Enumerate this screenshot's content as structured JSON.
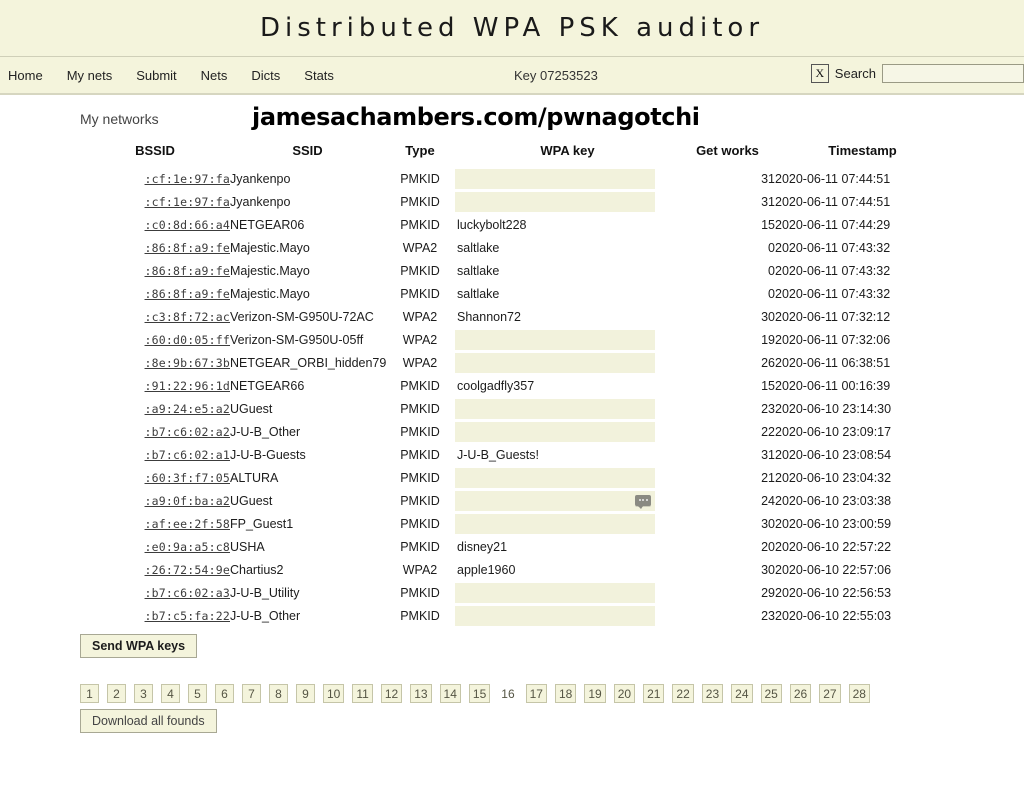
{
  "header": {
    "title": "Distributed WPA PSK auditor"
  },
  "nav": {
    "links": [
      {
        "label": "Home"
      },
      {
        "label": "My nets"
      },
      {
        "label": "Submit"
      },
      {
        "label": "Nets"
      },
      {
        "label": "Dicts"
      },
      {
        "label": "Stats"
      }
    ],
    "key_label": "Key 07253523",
    "close_label": "X",
    "search_label": "Search",
    "search_value": "",
    "search_placeholder": ""
  },
  "page": {
    "section_label": "My networks",
    "banner": "jamesachambers.com/pwnagotchi"
  },
  "table": {
    "columns": [
      "BSSID",
      "SSID",
      "Type",
      "WPA key",
      "Get works",
      "Timestamp"
    ],
    "rows": [
      {
        "bssid": ":cf:1e:97:fa",
        "ssid": "Jyankenpo",
        "type": "PMKID",
        "key": "",
        "key_is_input": true,
        "autofill": false,
        "works": "31",
        "timestamp": "2020-06-11 07:44:51"
      },
      {
        "bssid": ":cf:1e:97:fa",
        "ssid": "Jyankenpo",
        "type": "PMKID",
        "key": "",
        "key_is_input": true,
        "autofill": false,
        "works": "31",
        "timestamp": "2020-06-11 07:44:51"
      },
      {
        "bssid": ":c0:8d:66:a4",
        "ssid": "NETGEAR06",
        "type": "PMKID",
        "key": "luckybolt228",
        "key_is_input": false,
        "autofill": false,
        "works": "15",
        "timestamp": "2020-06-11 07:44:29"
      },
      {
        "bssid": ":86:8f:a9:fe",
        "ssid": "Majestic.Mayo",
        "type": "WPA2",
        "key": "saltlake",
        "key_is_input": false,
        "autofill": false,
        "works": "0",
        "timestamp": "2020-06-11 07:43:32"
      },
      {
        "bssid": ":86:8f:a9:fe",
        "ssid": "Majestic.Mayo",
        "type": "PMKID",
        "key": "saltlake",
        "key_is_input": false,
        "autofill": false,
        "works": "0",
        "timestamp": "2020-06-11 07:43:32"
      },
      {
        "bssid": ":86:8f:a9:fe",
        "ssid": "Majestic.Mayo",
        "type": "PMKID",
        "key": "saltlake",
        "key_is_input": false,
        "autofill": false,
        "works": "0",
        "timestamp": "2020-06-11 07:43:32"
      },
      {
        "bssid": ":c3:8f:72:ac",
        "ssid": "Verizon-SM-G950U-72AC",
        "type": "WPA2",
        "key": "Shannon72",
        "key_is_input": false,
        "autofill": false,
        "works": "30",
        "timestamp": "2020-06-11 07:32:12"
      },
      {
        "bssid": ":60:d0:05:ff",
        "ssid": "Verizon-SM-G950U-05ff",
        "type": "WPA2",
        "key": "",
        "key_is_input": true,
        "autofill": false,
        "works": "19",
        "timestamp": "2020-06-11 07:32:06"
      },
      {
        "bssid": ":8e:9b:67:3b",
        "ssid": "NETGEAR_ORBI_hidden79",
        "type": "WPA2",
        "key": "",
        "key_is_input": true,
        "autofill": false,
        "works": "26",
        "timestamp": "2020-06-11 06:38:51"
      },
      {
        "bssid": ":91:22:96:1d",
        "ssid": "NETGEAR66",
        "type": "PMKID",
        "key": "coolgadfly357",
        "key_is_input": false,
        "autofill": false,
        "works": "15",
        "timestamp": "2020-06-11 00:16:39"
      },
      {
        "bssid": ":a9:24:e5:a2",
        "ssid": "UGuest",
        "type": "PMKID",
        "key": "",
        "key_is_input": true,
        "autofill": false,
        "works": "23",
        "timestamp": "2020-06-10 23:14:30"
      },
      {
        "bssid": ":b7:c6:02:a2",
        "ssid": "J-U-B_Other",
        "type": "PMKID",
        "key": "",
        "key_is_input": true,
        "autofill": false,
        "works": "22",
        "timestamp": "2020-06-10 23:09:17"
      },
      {
        "bssid": ":b7:c6:02:a1",
        "ssid": "J-U-B-Guests",
        "type": "PMKID",
        "key": "J-U-B_Guests!",
        "key_is_input": false,
        "autofill": false,
        "works": "31",
        "timestamp": "2020-06-10 23:08:54"
      },
      {
        "bssid": ":60:3f:f7:05",
        "ssid": "ALTURA",
        "type": "PMKID",
        "key": "",
        "key_is_input": true,
        "autofill": false,
        "works": "21",
        "timestamp": "2020-06-10 23:04:32"
      },
      {
        "bssid": ":a9:0f:ba:a2",
        "ssid": "UGuest",
        "type": "PMKID",
        "key": "",
        "key_is_input": true,
        "autofill": true,
        "works": "24",
        "timestamp": "2020-06-10 23:03:38"
      },
      {
        "bssid": ":af:ee:2f:58",
        "ssid": "FP_Guest1",
        "type": "PMKID",
        "key": "",
        "key_is_input": true,
        "autofill": false,
        "works": "30",
        "timestamp": "2020-06-10 23:00:59"
      },
      {
        "bssid": ":e0:9a:a5:c8",
        "ssid": "USHA",
        "type": "PMKID",
        "key": "disney21",
        "key_is_input": false,
        "autofill": false,
        "works": "20",
        "timestamp": "2020-06-10 22:57:22"
      },
      {
        "bssid": ":26:72:54:9e",
        "ssid": "Chartius2",
        "type": "WPA2",
        "key": "apple1960",
        "key_is_input": false,
        "autofill": false,
        "works": "30",
        "timestamp": "2020-06-10 22:57:06"
      },
      {
        "bssid": ":b7:c6:02:a3",
        "ssid": "J-U-B_Utility",
        "type": "PMKID",
        "key": "",
        "key_is_input": true,
        "autofill": false,
        "works": "29",
        "timestamp": "2020-06-10 22:56:53"
      },
      {
        "bssid": ":b7:c5:fa:22",
        "ssid": "J-U-B_Other",
        "type": "PMKID",
        "key": "",
        "key_is_input": true,
        "autofill": false,
        "works": "23",
        "timestamp": "2020-06-10 22:55:03"
      }
    ]
  },
  "actions": {
    "send_keys_label": "Send WPA keys",
    "download_label": "Download all founds"
  },
  "pagination": {
    "current": "16",
    "pages": [
      "1",
      "2",
      "3",
      "4",
      "5",
      "6",
      "7",
      "8",
      "9",
      "10",
      "11",
      "12",
      "13",
      "14",
      "15",
      "16",
      "17",
      "18",
      "19",
      "20",
      "21",
      "22",
      "23",
      "24",
      "25",
      "26",
      "27",
      "28"
    ]
  },
  "colors": {
    "header_bg": "#f4f4dc",
    "input_bg": "#f2f2dc",
    "page_bg": "#ffffff",
    "text": "#1c1c1c"
  }
}
